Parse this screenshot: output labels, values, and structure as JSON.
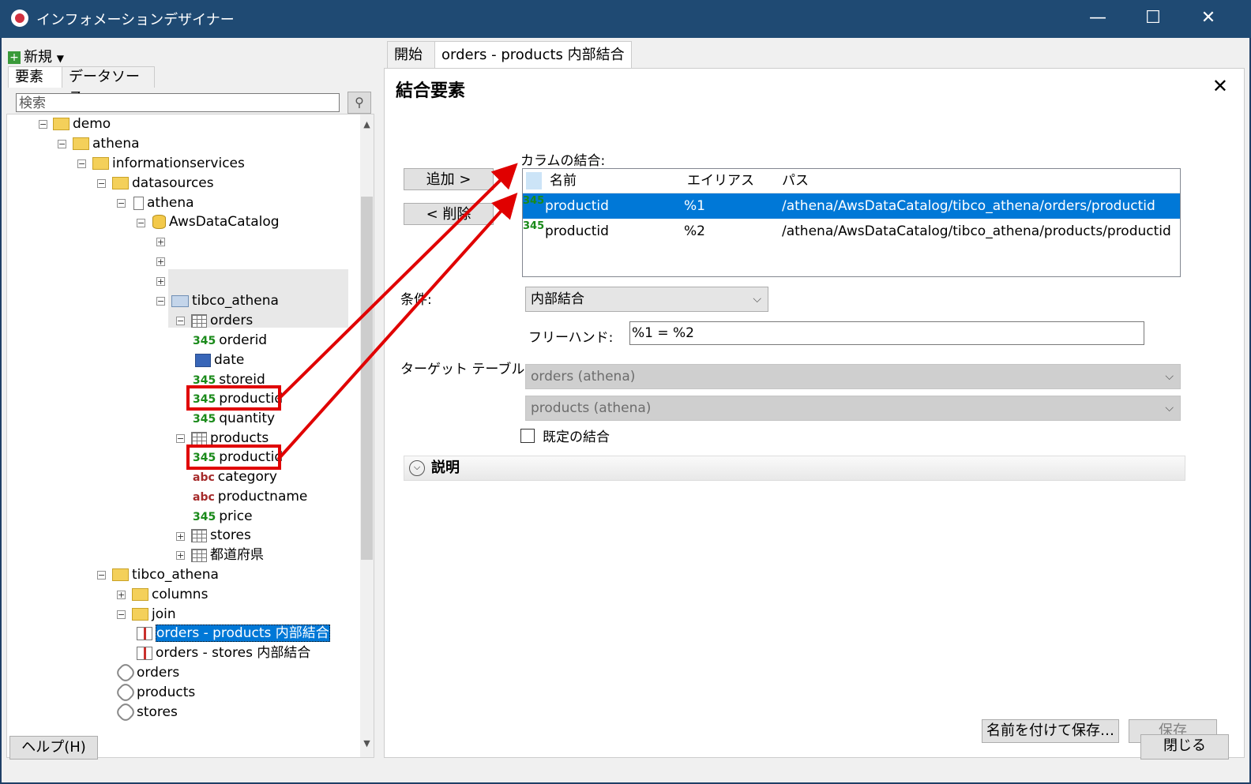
{
  "window": {
    "title": "インフォメーションデザイナー",
    "minimize": "—",
    "maximize": "☐",
    "close": "✕"
  },
  "left": {
    "new_button": "新規",
    "tabs": [
      "要素",
      "データソース"
    ],
    "search_placeholder": "検索",
    "tree": {
      "demo": "demo",
      "athena": "athena",
      "informationservices": "informationservices",
      "datasources": "datasources",
      "athena2": "athena",
      "awsdatacatalog": "AwsDataCatalog",
      "tibco_athena": "tibco_athena",
      "orders": "orders",
      "orderid": "orderid",
      "date": "date",
      "storeid": "storeid",
      "productid1": "productid",
      "quantity": "quantity",
      "products": "products",
      "productid2": "productid",
      "category": "category",
      "productname": "productname",
      "price": "price",
      "stores": "stores",
      "prefecture": "都道府県",
      "tibco_athena2": "tibco_athena",
      "columns": "columns",
      "join": "join",
      "join1": "orders - products 内部結合",
      "join2": "orders - stores 内部結合",
      "link_orders": "orders",
      "link_products": "products",
      "link_stores": "stores"
    },
    "type_num": "345",
    "type_str": "abc"
  },
  "right": {
    "tabs": [
      "開始",
      "orders - products 内部結合"
    ],
    "heading": "結合要素",
    "close": "✕",
    "add_button": "追加 >",
    "remove_button": "< 削除",
    "join_columns_label": "カラムの結合:",
    "grid": {
      "headers": [
        "名前",
        "エイリアス",
        "パス"
      ],
      "rows": [
        {
          "type": "345",
          "name": "productid",
          "alias": "%1",
          "path": "/athena/AwsDataCatalog/tibco_athena/orders/productid"
        },
        {
          "type": "345",
          "name": "productid",
          "alias": "%2",
          "path": "/athena/AwsDataCatalog/tibco_athena/products/productid"
        }
      ]
    },
    "condition_label": "条件:",
    "condition_value": "内部結合",
    "freehand_label": "フリーハンド:",
    "freehand_value": "%1 = %2",
    "target_label": "ターゲット テーブル:",
    "target1": "orders (athena)",
    "target2": "products (athena)",
    "default_join_label": "既定の結合",
    "description_label": "説明",
    "save_as_button": "名前を付けて保存…",
    "save_button": "保存"
  },
  "footer": {
    "help_button": "ヘルプ(H)",
    "close_button": "閉じる"
  },
  "colors": {
    "titlebar": "#1f4a73",
    "selection": "#0078d7",
    "highlight": "#e00000",
    "num_type": "#1a8a1a",
    "str_type": "#a52a2a"
  }
}
